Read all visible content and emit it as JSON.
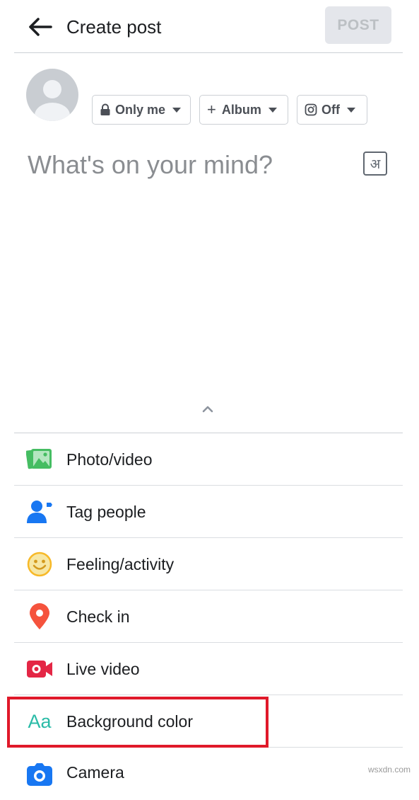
{
  "header": {
    "title": "Create post",
    "post_label": "POST"
  },
  "audience": {
    "privacy_label": "Only me",
    "album_label": "Album",
    "instagram_label": "Off"
  },
  "composer": {
    "placeholder": "What's on your mind?",
    "transliterate_glyph": "अ"
  },
  "menu": {
    "items": [
      {
        "label": "Photo/video",
        "icon": "photo-video-icon"
      },
      {
        "label": "Tag people",
        "icon": "tag-people-icon"
      },
      {
        "label": "Feeling/activity",
        "icon": "feeling-activity-icon"
      },
      {
        "label": "Check in",
        "icon": "check-in-icon"
      },
      {
        "label": "Live video",
        "icon": "live-video-icon"
      },
      {
        "label": "Background color",
        "icon": "background-color-icon",
        "highlighted": true
      },
      {
        "label": "Camera",
        "icon": "camera-icon"
      }
    ],
    "bg_color_glyph": "Aa"
  },
  "watermark": "wsxdn.com",
  "colors": {
    "highlight": "#e0192a",
    "photo_green": "#45bd62",
    "tag_blue": "#1877f2",
    "feeling_yellow": "#f7b928",
    "checkin_red": "#f5533d",
    "live_red": "#e42645",
    "bg_teal": "#2abba7"
  }
}
